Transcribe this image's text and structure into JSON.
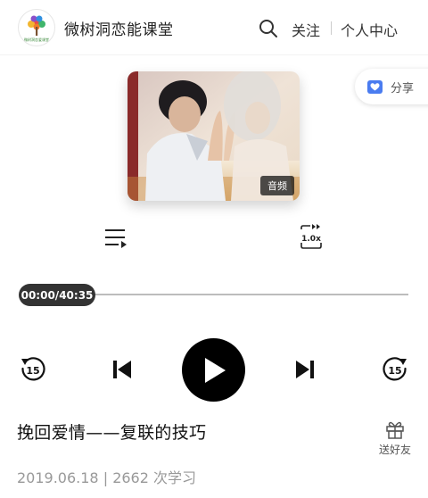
{
  "header": {
    "logo_text": "微树洞恋爱课堂",
    "title": "微树洞恋能课堂",
    "follow_label": "关注",
    "profile_label": "个人中心"
  },
  "share": {
    "label": "分享"
  },
  "cover": {
    "badge": "音频"
  },
  "controls": {
    "speed_label": "1.0x",
    "skip_seconds": "15"
  },
  "progress": {
    "time": "00:00/40:35",
    "fraction": 0
  },
  "course": {
    "title": "挽回爱情——复联的技巧",
    "date": "2019.06.18",
    "separator": "|",
    "views": "2662 次学习"
  },
  "gift": {
    "label": "送好友"
  },
  "colors": {
    "accent": "#4a7cf0",
    "dark": "#333333",
    "muted": "#999999"
  }
}
